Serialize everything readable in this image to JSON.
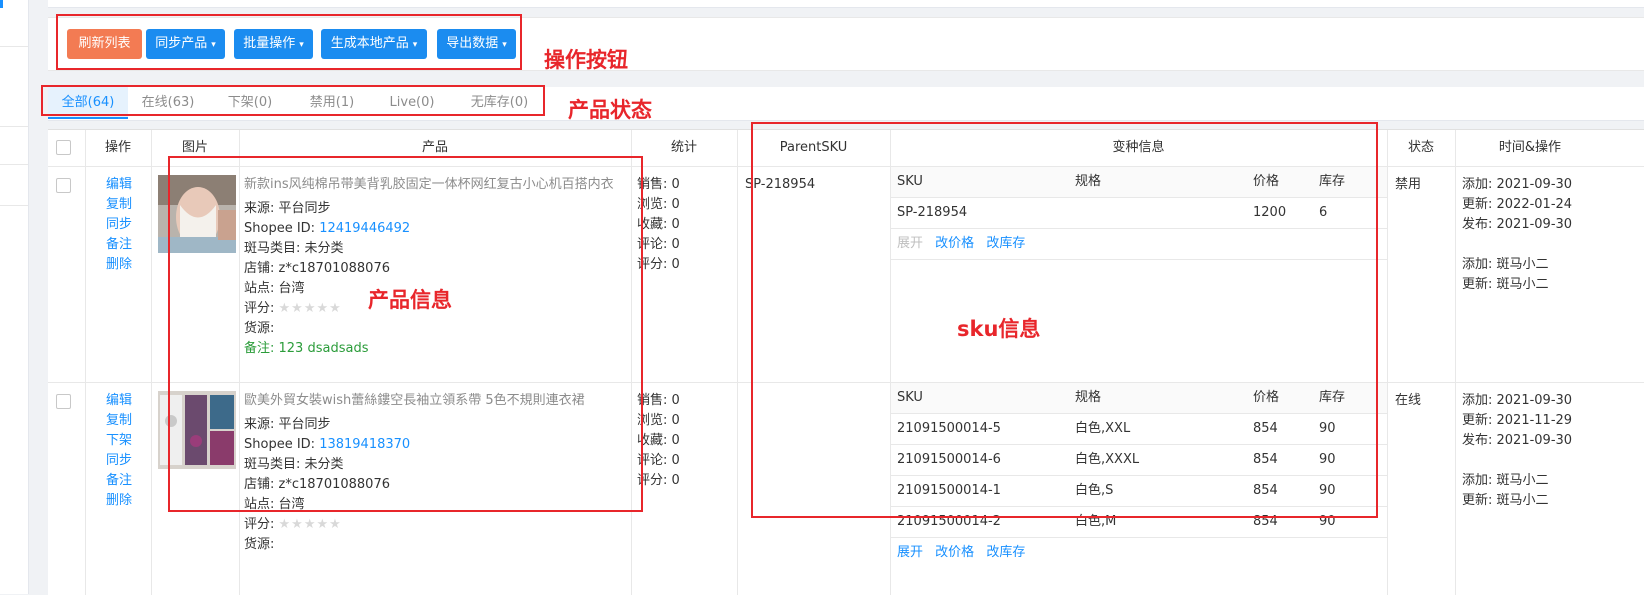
{
  "toolbar": {
    "refresh": "刷新列表",
    "sync": "同步产品",
    "batch": "批量操作",
    "generate": "生成本地产品",
    "export": "导出数据",
    "caret": "▾"
  },
  "tabs": [
    {
      "label": "全部(64)"
    },
    {
      "label": "在线(63)"
    },
    {
      "label": "下架(0)"
    },
    {
      "label": "禁用(1)"
    },
    {
      "label": "Live(0)"
    },
    {
      "label": "无库存(0)"
    }
  ],
  "table": {
    "headers": {
      "ops": "操作",
      "image": "图片",
      "product": "产品",
      "stats": "统计",
      "parent_sku": "ParentSKU",
      "variant": "变种信息",
      "status": "状态",
      "time": "时间&操作"
    },
    "variant_cols": {
      "sku": "SKU",
      "spec": "规格",
      "price": "价格",
      "stock": "库存"
    },
    "variant_links": {
      "expand": "展开",
      "edit_price": "改价格",
      "edit_stock": "改库存"
    },
    "rows": [
      {
        "ops": [
          "编辑",
          "复制",
          "同步",
          "备注",
          "删除"
        ],
        "title": "新款ins风纯棉吊带美背乳胶固定一体杯网红复古小心机百搭内衣",
        "source_label": "来源:",
        "source": "平台同步",
        "shopee_label": "Shopee ID:",
        "shopee_id": "12419446492",
        "category_label": "斑马类目:",
        "category": "未分类",
        "shop_label": "店铺:",
        "shop": "z*c18701088076",
        "site_label": "站点:",
        "site": "台湾",
        "rating_label": "评分:",
        "stars": "★★★★★",
        "supply_label": "货源:",
        "note": "备注: 123 dsadsads",
        "stats": [
          "销售: 0",
          "浏览: 0",
          "收藏: 0",
          "评论: 0",
          "评分: 0"
        ],
        "parent_sku": "SP-218954",
        "variants": [
          {
            "sku": "SP-218954",
            "spec": "",
            "price": "1200",
            "stock": "6"
          }
        ],
        "status": "禁用",
        "times": [
          "添加: 2021-09-30",
          "更新: 2022-01-24",
          "发布: 2021-09-30",
          "",
          "添加: 斑马小二",
          "更新: 斑马小二"
        ]
      },
      {
        "ops": [
          "编辑",
          "复制",
          "下架",
          "同步",
          "备注",
          "删除"
        ],
        "title": "歐美外貿女裝wish蕾絲鏤空長袖立領系帶 5色不規則連衣裙",
        "source_label": "来源:",
        "source": "平台同步",
        "shopee_label": "Shopee ID:",
        "shopee_id": "13819418370",
        "category_label": "斑马类目:",
        "category": "未分类",
        "shop_label": "店铺:",
        "shop": "z*c18701088076",
        "site_label": "站点:",
        "site": "台湾",
        "rating_label": "评分:",
        "stars": "★★★★★",
        "supply_label": "货源:",
        "stats": [
          "销售: 0",
          "浏览: 0",
          "收藏: 0",
          "评论: 0",
          "评分: 0"
        ],
        "parent_sku": "",
        "variants": [
          {
            "sku": "21091500014-5",
            "spec": "白色,XXL",
            "price": "854",
            "stock": "90"
          },
          {
            "sku": "21091500014-6",
            "spec": "白色,XXXL",
            "price": "854",
            "stock": "90"
          },
          {
            "sku": "21091500014-1",
            "spec": "白色,S",
            "price": "854",
            "stock": "90"
          },
          {
            "sku": "21091500014-2",
            "spec": "白色,M",
            "price": "854",
            "stock": "90"
          }
        ],
        "status": "在线",
        "times": [
          "添加: 2021-09-30",
          "更新: 2021-11-29",
          "发布: 2021-09-30",
          "",
          "添加: 斑马小二",
          "更新: 斑马小二"
        ]
      }
    ]
  },
  "annotations": {
    "buttons": "操作按钮",
    "status": "产品状态",
    "product": "产品信息",
    "sku": "sku信息"
  },
  "colors": {
    "accent": "#1890ff",
    "orange": "#f37b53",
    "button_blue": "#1b8cf0",
    "annotation": "#e8262b",
    "note_green": "#2b9c3a"
  }
}
